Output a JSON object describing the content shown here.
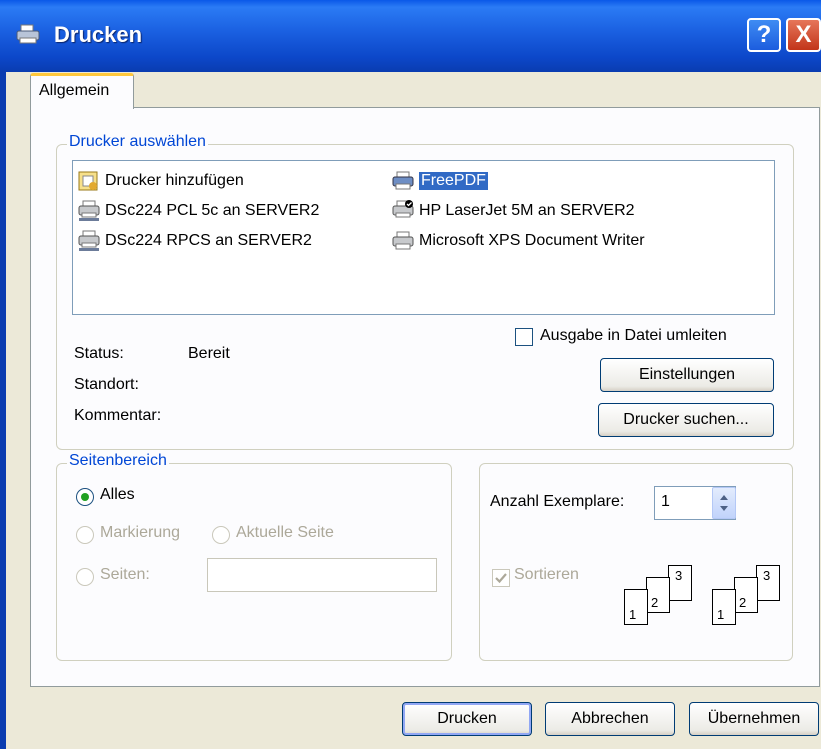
{
  "window": {
    "title": "Drucken",
    "help_glyph": "?",
    "close_glyph": "X"
  },
  "tabs": [
    {
      "label": "Allgemein"
    }
  ],
  "printer_group": {
    "title": "Drucker auswählen",
    "printers": [
      {
        "label": "Drucker hinzufügen",
        "icon": "add-printer-icon"
      },
      {
        "label": "DSc224 PCL 5c an SERVER2",
        "icon": "network-printer-icon"
      },
      {
        "label": "DSc224 RPCS an SERVER2",
        "icon": "network-printer-icon"
      },
      {
        "label": "FreePDF",
        "icon": "printer-icon",
        "selected": true
      },
      {
        "label": "HP LaserJet 5M an SERVER2",
        "icon": "default-network-printer-icon"
      },
      {
        "label": "Microsoft XPS Document Writer",
        "icon": "printer-icon"
      }
    ],
    "status_label": "Status:",
    "status_value": "Bereit",
    "location_label": "Standort:",
    "comment_label": "Kommentar:",
    "print_to_file_label": "Ausgabe in Datei umleiten",
    "settings_button": "Einstellungen",
    "find_printer_button": "Drucker suchen..."
  },
  "page_range": {
    "title": "Seitenbereich",
    "all_label": "Alles",
    "selection_label": "Markierung",
    "current_page_label": "Aktuelle Seite",
    "pages_label": "Seiten:",
    "pages_value": ""
  },
  "copies": {
    "count_label": "Anzahl Exemplare:",
    "count_value": "1",
    "collate_label": "Sortieren",
    "collate_checked": true,
    "page_numbers": [
      "1",
      "2",
      "3"
    ]
  },
  "footer": {
    "print_button": "Drucken",
    "cancel_button": "Abbrechen",
    "apply_button": "Übernehmen"
  },
  "colors": {
    "titlebar": "#0A58E8",
    "group_title": "#0046D5",
    "selection": "#316AC5",
    "background": "#ECE9D8"
  }
}
